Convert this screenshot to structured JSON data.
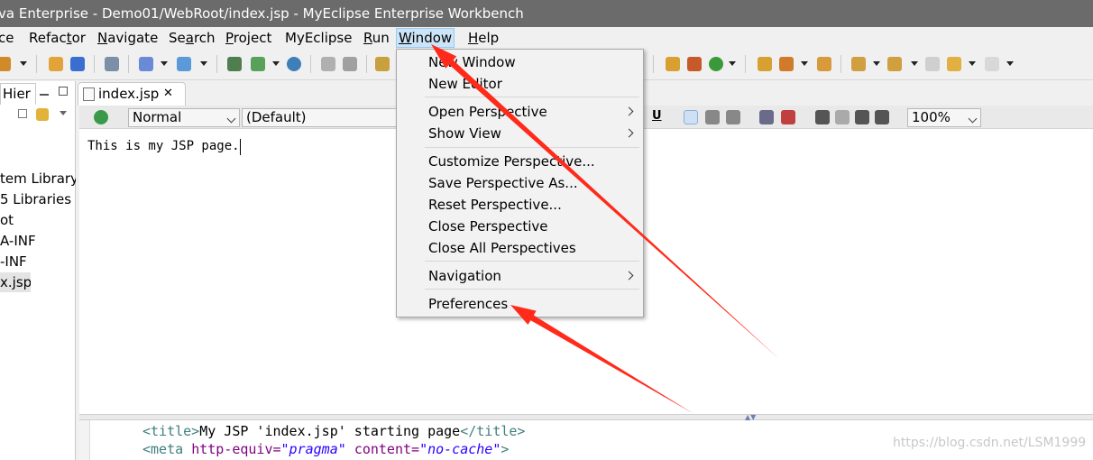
{
  "window": {
    "title": "va Enterprise - Demo01/WebRoot/index.jsp - MyEclipse Enterprise Workbench"
  },
  "menubar": {
    "items": [
      {
        "label": "ce",
        "mnemonic": ""
      },
      {
        "label": "Refactor",
        "pre": "Refac",
        "mn": "t",
        "post": "or"
      },
      {
        "label": "Navigate",
        "pre": "",
        "mn": "N",
        "post": "avigate"
      },
      {
        "label": "Search",
        "pre": "Se",
        "mn": "a",
        "post": "rch"
      },
      {
        "label": "Project",
        "pre": "",
        "mn": "P",
        "post": "roject"
      },
      {
        "label": "MyEclipse",
        "pre": "MyEclipse",
        "mn": "",
        "post": ""
      },
      {
        "label": "Run",
        "pre": "",
        "mn": "R",
        "post": "un"
      },
      {
        "label": "Window",
        "pre": "",
        "mn": "W",
        "post": "indow"
      },
      {
        "label": "Help",
        "pre": "",
        "mn": "H",
        "post": "elp"
      }
    ]
  },
  "left_panel": {
    "tab_label": "Hier",
    "tree": [
      "tem Library",
      "5 Libraries",
      "ot",
      "A-INF",
      "-INF",
      "x.jsp"
    ]
  },
  "editor": {
    "tab_label": "index.jsp",
    "style_combo": "Normal",
    "font_combo": "(Default)",
    "zoom_combo": "100%",
    "bold_label": "U",
    "design_text": "This is my JSP page.",
    "source_lines": [
      {
        "tag_open": "<title>",
        "text": "My JSP 'index.jsp' starting page",
        "tag_close": "</title>"
      },
      {
        "tag_open": "<meta",
        "attr1": "http-equiv=",
        "val1": "\"pragma\"",
        "attr2": "content=",
        "val2": "\"no-cache\"",
        "tag_close": ">"
      }
    ]
  },
  "window_menu": {
    "items": [
      {
        "label": "New Window",
        "submenu": false
      },
      {
        "label": "New Editor",
        "submenu": false
      },
      {
        "label": "Open Perspective",
        "submenu": true
      },
      {
        "label": "Show View",
        "submenu": true
      },
      {
        "label": "Customize Perspective...",
        "submenu": false
      },
      {
        "label": "Save Perspective As...",
        "submenu": false
      },
      {
        "label": "Reset Perspective...",
        "submenu": false
      },
      {
        "label": "Close Perspective",
        "submenu": false
      },
      {
        "label": "Close All Perspectives",
        "submenu": false
      },
      {
        "label": "Navigation",
        "submenu": true
      },
      {
        "label": "Preferences",
        "submenu": false
      }
    ]
  },
  "annotation": {
    "arrow_color": "#ff2a1a"
  },
  "watermark": "https://blog.csdn.net/LSM1999"
}
